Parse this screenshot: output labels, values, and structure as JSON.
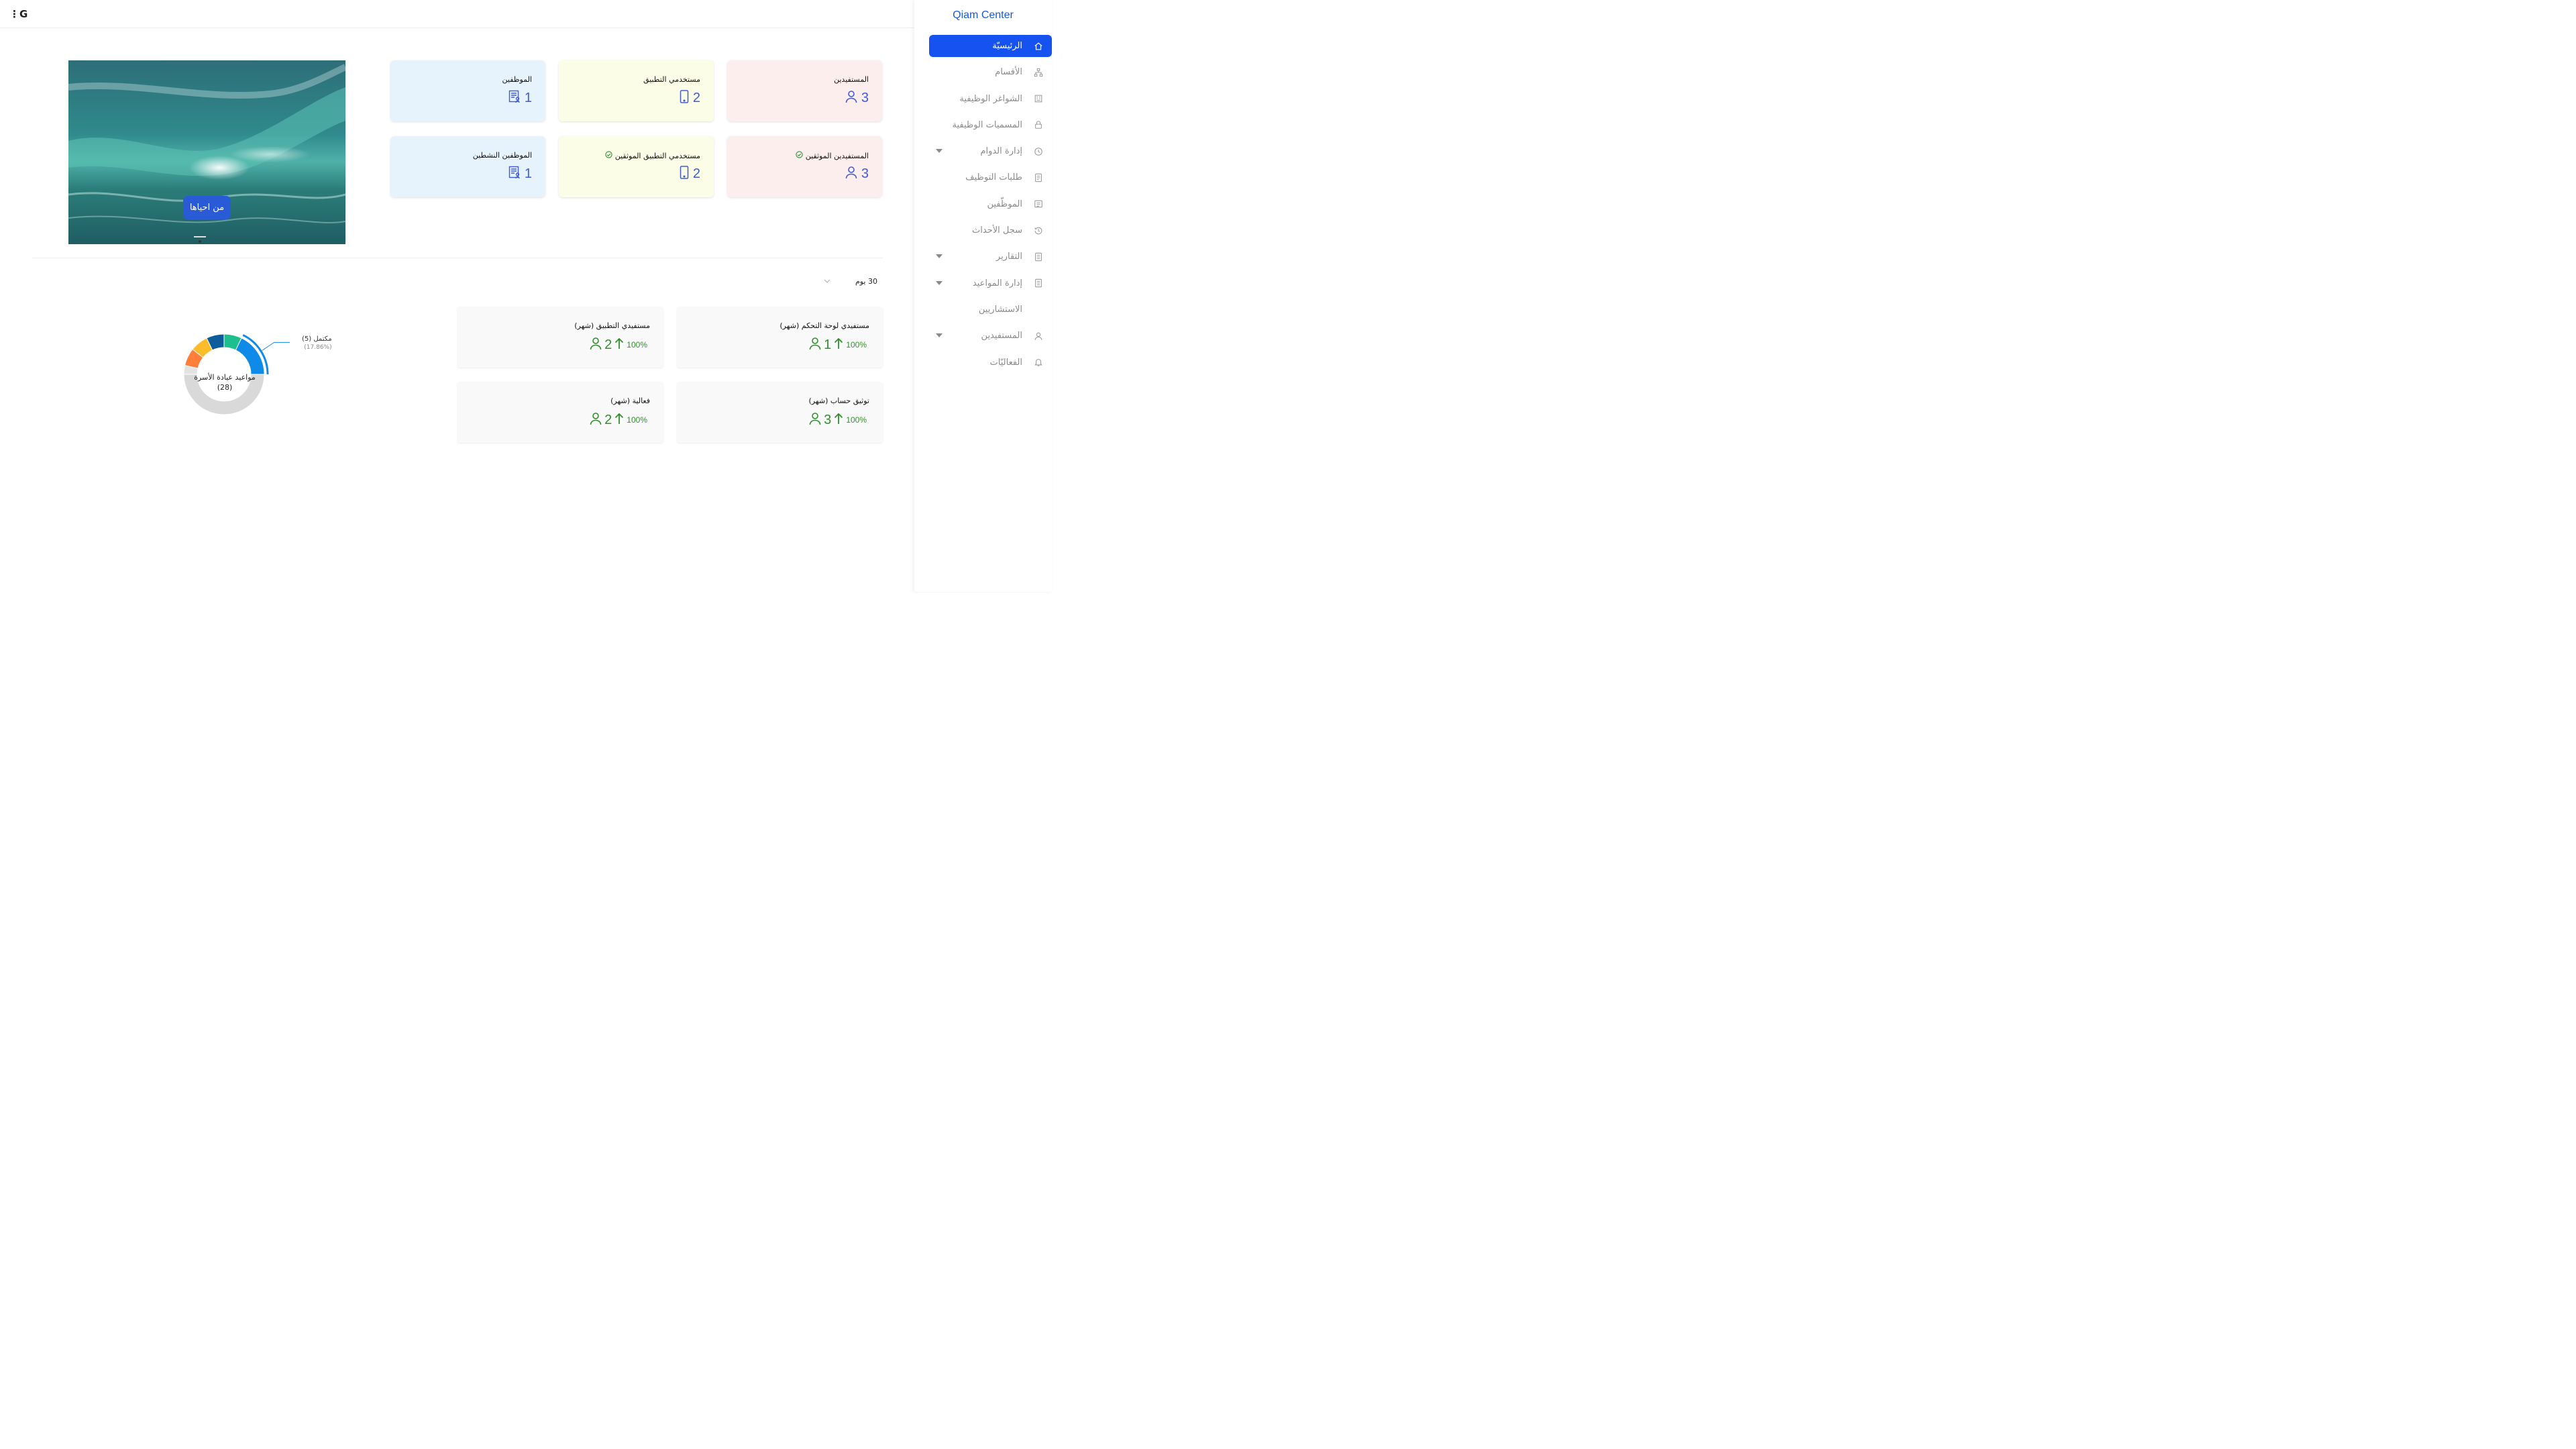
{
  "app": {
    "brand": "Qiam Center",
    "logo_text": "⋮G"
  },
  "sidebar": {
    "items": [
      {
        "label": "الرئيسيّة",
        "icon": "home-icon",
        "active": true,
        "has_children": false
      },
      {
        "label": "الأقسام",
        "icon": "sitemap-icon",
        "active": false,
        "has_children": false
      },
      {
        "label": "الشواغر الوظيفية",
        "icon": "building-icon",
        "active": false,
        "has_children": false
      },
      {
        "label": "المسميات الوظيفية",
        "icon": "lock-icon",
        "active": false,
        "has_children": false
      },
      {
        "label": "إدارة الدوام",
        "icon": "clock-icon",
        "active": false,
        "has_children": true
      },
      {
        "label": "طلبات التوظيف",
        "icon": "document-icon",
        "active": false,
        "has_children": false
      },
      {
        "label": "الموظّفين",
        "icon": "id-card-icon",
        "active": false,
        "has_children": false
      },
      {
        "label": "سجل الأحداث",
        "icon": "history-icon",
        "active": false,
        "has_children": false
      },
      {
        "label": "التقارير",
        "icon": "report-icon",
        "active": false,
        "has_children": true
      },
      {
        "label": "إدارة المواعيد",
        "icon": "calendar-icon",
        "active": false,
        "has_children": true
      },
      {
        "label": "الاستشاريين",
        "icon": "users-icon",
        "active": false,
        "has_children": false
      },
      {
        "label": "المستفيدين",
        "icon": "user-icon",
        "active": false,
        "has_children": true
      },
      {
        "label": "الفعاليّات",
        "icon": "bell-icon",
        "active": false,
        "has_children": false
      }
    ]
  },
  "hero": {
    "button_label": "من احياها"
  },
  "stats": [
    {
      "label": "المستفيدين",
      "value": "3",
      "icon": "user-icon",
      "verified": false
    },
    {
      "label": "مستخدمي التطبيق",
      "value": "2",
      "icon": "mobile-icon",
      "verified": false
    },
    {
      "label": "الموظفين",
      "value": "1",
      "icon": "employee-icon",
      "verified": false
    },
    {
      "label": "المستفيدين الموثقين",
      "value": "3",
      "icon": "user-icon",
      "verified": true
    },
    {
      "label": "مستخدمي التطبيق الموثقين",
      "value": "2",
      "icon": "mobile-icon",
      "verified": true
    },
    {
      "label": "الموظفين النشطين",
      "value": "1",
      "icon": "employee-icon",
      "verified": false
    }
  ],
  "period": {
    "selected": "30 يوم"
  },
  "metrics": [
    {
      "label": "مستفيدي لوحة التحكم (شهر)",
      "value": "1",
      "change": "100%"
    },
    {
      "label": "مستفيدي التطبيق (شهر)",
      "value": "2",
      "change": "100%"
    },
    {
      "label": "توثيق حساب (شهر)",
      "value": "3",
      "change": "100%"
    },
    {
      "label": "فعالية (شهر)",
      "value": "2",
      "change": "100%"
    }
  ],
  "chart_data": {
    "type": "pie",
    "title": "مواعيد عيادة الأسرة",
    "total": "(28)",
    "highlight": {
      "label": "مكتمل (5)",
      "percent": "(17.86%)"
    },
    "slices": [
      {
        "value": 1,
        "color": "#e3e3e3"
      },
      {
        "value": 2,
        "color": "#ff7f3a"
      },
      {
        "value": 2,
        "color": "#fbbc2a"
      },
      {
        "value": 2,
        "color": "#0e5c99"
      },
      {
        "value": 2,
        "color": "#1dbf8c"
      },
      {
        "value": 5,
        "color": "#0e8ae8"
      },
      {
        "value": 14,
        "color": "#d9d9d9"
      }
    ]
  },
  "colors": {
    "accent": "#1652f0",
    "positive": "#2e8f2b",
    "stat_value": "#3f5bd6"
  }
}
